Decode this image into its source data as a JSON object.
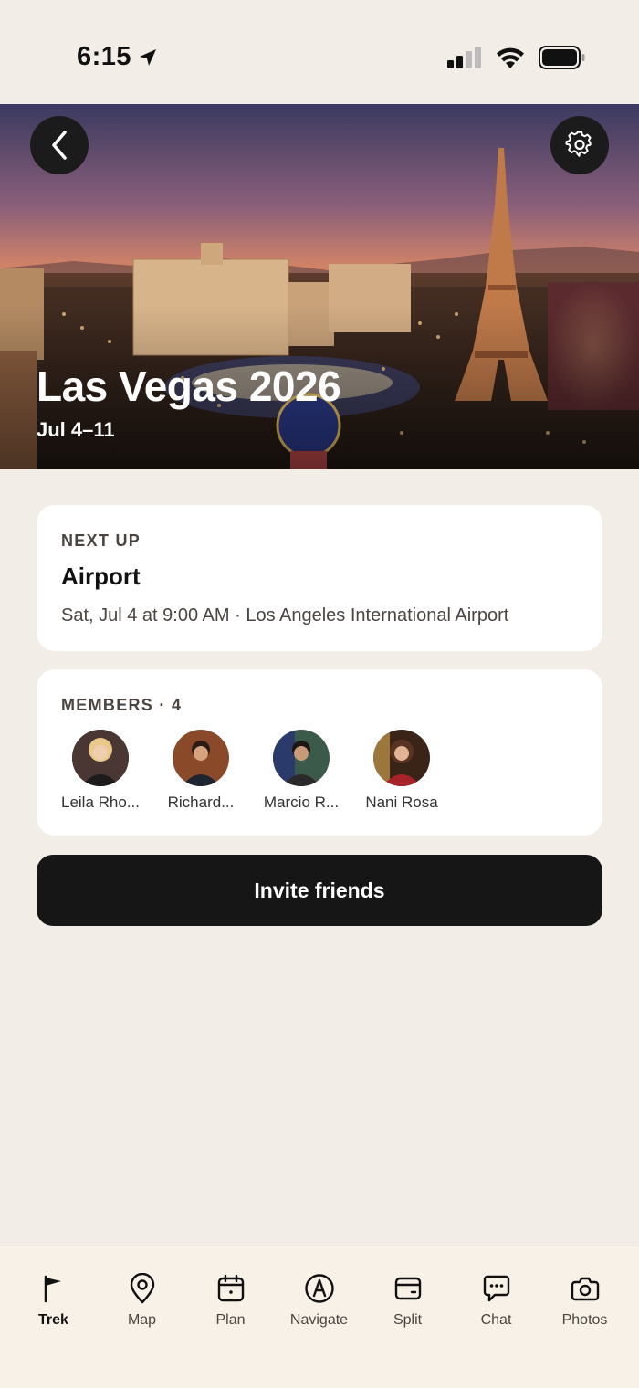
{
  "status_bar": {
    "time": "6:15"
  },
  "hero": {
    "title": "Las Vegas 2026",
    "dates": "Jul 4–11"
  },
  "next_up": {
    "eyebrow": "NEXT UP",
    "title": "Airport",
    "subtitle": "Sat, Jul 4 at 9:00 AM · Los Angeles International Airport"
  },
  "members": {
    "eyebrow": "MEMBERS · 4",
    "list": [
      {
        "name": "Leila Rho..."
      },
      {
        "name": "Richard..."
      },
      {
        "name": "Marcio R..."
      },
      {
        "name": "Nani Rosa"
      }
    ]
  },
  "invite_button": "Invite friends",
  "tabs": [
    {
      "label": "Trek",
      "icon": "flag-icon",
      "active": true
    },
    {
      "label": "Map",
      "icon": "map-pin-icon"
    },
    {
      "label": "Plan",
      "icon": "calendar-icon"
    },
    {
      "label": "Navigate",
      "icon": "navigate-icon"
    },
    {
      "label": "Split",
      "icon": "wallet-icon"
    },
    {
      "label": "Chat",
      "icon": "chat-icon"
    },
    {
      "label": "Photos",
      "icon": "camera-icon"
    }
  ],
  "colors": {
    "background": "#f2ede6",
    "card": "#ffffff",
    "button": "#161616",
    "tab_bar": "#f7f1e8"
  }
}
